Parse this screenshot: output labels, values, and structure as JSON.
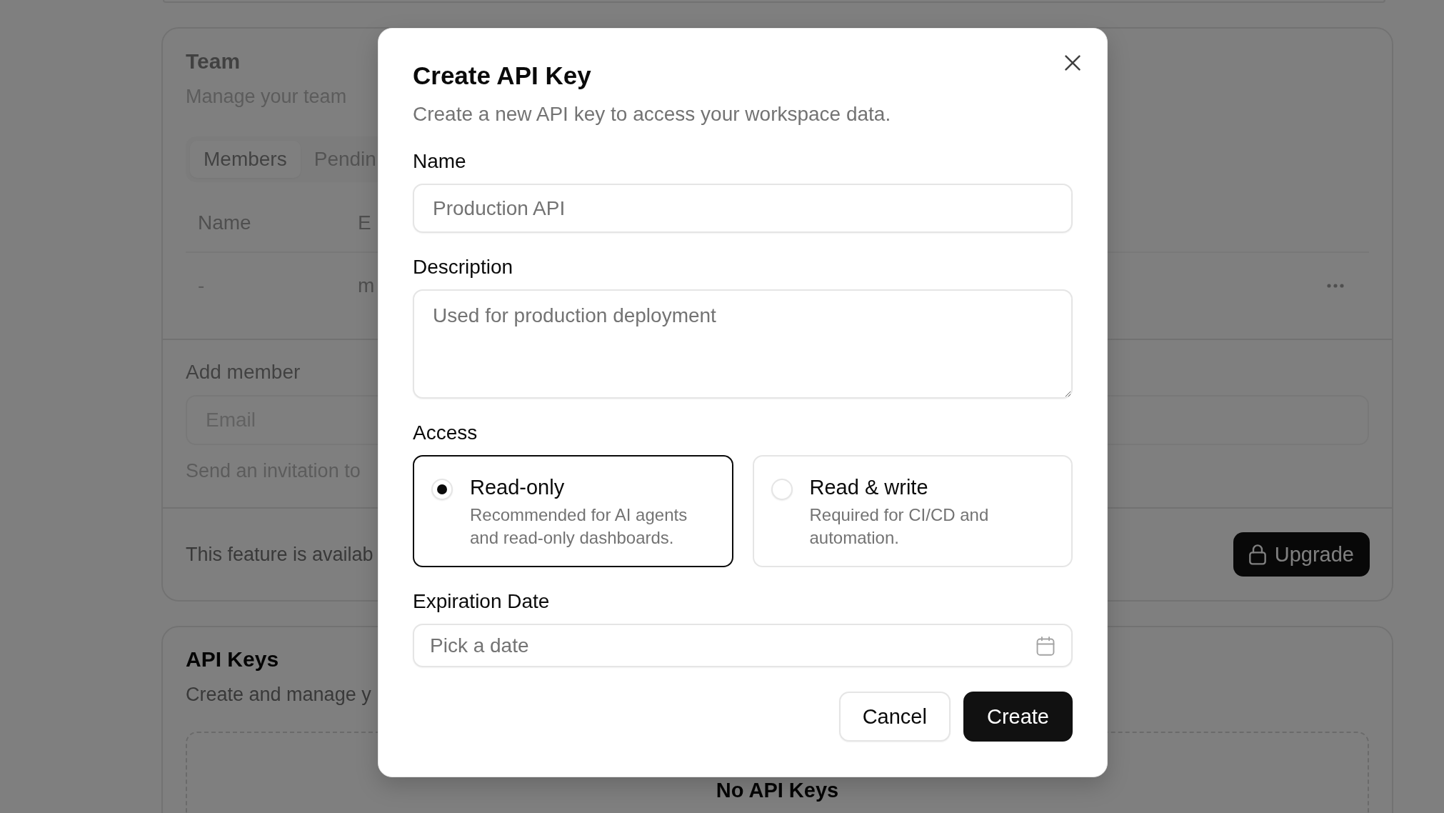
{
  "background": {
    "team": {
      "title": "Team",
      "subtitle": "Manage your team",
      "locked": true,
      "tabs": [
        {
          "label": "Members",
          "selected": true
        },
        {
          "label": "Pendin",
          "selected": false
        }
      ],
      "table": {
        "columns": [
          "Name",
          "E"
        ],
        "rows": [
          {
            "cells": [
              "-",
              "m"
            ]
          }
        ]
      },
      "add_member": {
        "label": "Add member",
        "placeholder": "Email",
        "helper": "Send an invitation to"
      },
      "footer": {
        "text": "This feature is availab",
        "button": "Upgrade"
      }
    },
    "api_keys": {
      "title": "API Keys",
      "subtitle": "Create and manage y",
      "empty_title": "No API Keys"
    }
  },
  "dialog": {
    "title": "Create API Key",
    "subtitle": "Create a new API key to access your workspace data.",
    "fields": [
      {
        "kind": "input",
        "label": "Name",
        "placeholder": "Production API"
      },
      {
        "kind": "textarea",
        "label": "Description",
        "placeholder": "Used for production deployment"
      }
    ],
    "access": {
      "label": "Access",
      "options": [
        {
          "title": "Read-only",
          "description": "Recommended for AI agents and read-only dashboards.",
          "selected": true
        },
        {
          "title": "Read & write",
          "description": "Required for CI/CD and automation.",
          "selected": false
        }
      ]
    },
    "expiration": {
      "label": "Expiration Date",
      "placeholder": "Pick a date"
    },
    "buttons": [
      {
        "label": "Cancel",
        "kind": "secondary"
      },
      {
        "label": "Create",
        "kind": "primary"
      }
    ]
  }
}
